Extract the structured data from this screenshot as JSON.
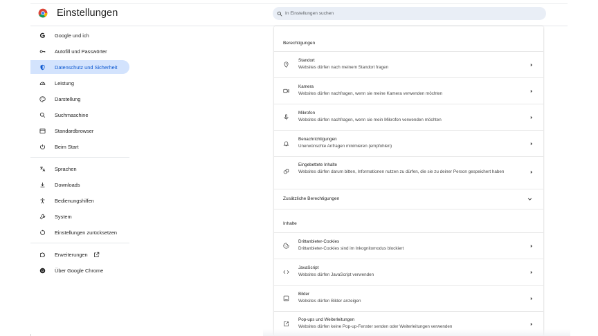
{
  "header": {
    "title": "Einstellungen",
    "search_placeholder": "In Einstellungen suchen"
  },
  "sidebar": {
    "items": [
      {
        "label": "Google und ich",
        "icon": "google-g-icon"
      },
      {
        "label": "Autofill und Passwörter",
        "icon": "key-icon"
      },
      {
        "label": "Datenschutz und Sicherheit",
        "icon": "shield-icon",
        "active": true
      },
      {
        "label": "Leistung",
        "icon": "gauge-icon"
      },
      {
        "label": "Darstellung",
        "icon": "palette-icon"
      },
      {
        "label": "Suchmaschine",
        "icon": "search-icon"
      },
      {
        "label": "Standardbrowser",
        "icon": "browser-window-icon"
      },
      {
        "label": "Beim Start",
        "icon": "power-icon"
      },
      {
        "label": "Sprachen",
        "icon": "translate-icon"
      },
      {
        "label": "Downloads",
        "icon": "download-icon"
      },
      {
        "label": "Bedienungshilfen",
        "icon": "accessibility-icon"
      },
      {
        "label": "System",
        "icon": "wrench-icon"
      },
      {
        "label": "Einstellungen zurücksetzen",
        "icon": "reset-icon"
      },
      {
        "label": "Erweiterungen",
        "icon": "puzzle-icon"
      },
      {
        "label": "Über Google Chrome",
        "icon": "chrome-icon"
      }
    ]
  },
  "main": {
    "permissions_title": "Berechtigungen",
    "permissions": [
      {
        "title": "Standort",
        "subtitle": "Websites dürfen nach meinem Standort fragen",
        "icon": "location-pin-icon"
      },
      {
        "title": "Kamera",
        "subtitle": "Websites dürfen nachfragen, wenn sie meine Kamera verwenden möchten",
        "icon": "camera-icon"
      },
      {
        "title": "Mikrofon",
        "subtitle": "Websites dürfen nachfragen, wenn sie mein Mikrofon verwenden möchten",
        "icon": "microphone-icon"
      },
      {
        "title": "Benachrichtigungen",
        "subtitle": "Unerwünschte Anfragen minimieren (empfohlen)",
        "icon": "bell-icon"
      },
      {
        "title": "Eingebettete Inhalte",
        "subtitle": "Websites dürfen darum bitten, Informationen nutzen zu dürfen, die sie zu deiner Person gespeichert haben",
        "icon": "embedded-content-icon"
      }
    ],
    "additional_permissions_label": "Zusätzliche Berechtigungen",
    "content_title": "Inhalte",
    "content": [
      {
        "title": "Drittanbieter-Cookies",
        "subtitle": "Drittanbieter-Cookies sind im Inkognitomodus blockiert",
        "icon": "cookie-icon"
      },
      {
        "title": "JavaScript",
        "subtitle": "Websites dürfen JavaScript verwenden",
        "icon": "code-icon"
      },
      {
        "title": "Bilder",
        "subtitle": "Websites dürfen Bilder anzeigen",
        "icon": "image-icon"
      },
      {
        "title": "Pop-ups und Weiterleitungen",
        "subtitle": "Websites dürfen keine Pop-up-Fenster senden oder Weiterleitungen verwenden",
        "icon": "popup-icon"
      }
    ]
  },
  "colors": {
    "accent": "#0b57d0",
    "active_bg": "#d3e3fd",
    "search_bg": "#e9eef6"
  }
}
